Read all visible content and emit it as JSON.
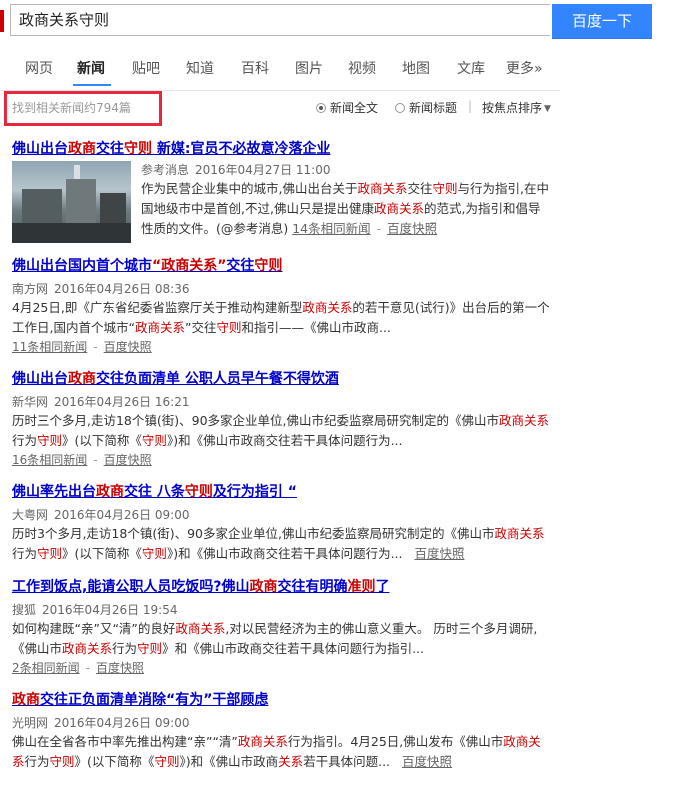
{
  "search": {
    "query": "政商关系守则",
    "button_label": "百度一下"
  },
  "nav": {
    "tabs": [
      {
        "label": "网页"
      },
      {
        "label": "新闻"
      },
      {
        "label": "贴吧"
      },
      {
        "label": "知道"
      },
      {
        "label": "百科"
      },
      {
        "label": "图片"
      },
      {
        "label": "视频"
      },
      {
        "label": "地图"
      },
      {
        "label": "文库"
      },
      {
        "label": "更多»"
      }
    ],
    "active": "新闻"
  },
  "toolbar": {
    "result_count": "找到相关新闻约794篇",
    "filter_full": "新闻全文",
    "filter_title": "新闻标题",
    "sort_label": "按焦点排序"
  },
  "results": [
    {
      "title_parts": [
        "佛山出台",
        "政商",
        "交往",
        "守则",
        " 新媒:官员不必故意冷落企业"
      ],
      "source": "参考消息",
      "date": "2016年04月27日 11:00",
      "summary_parts": [
        "作为民营企业集中的城市,佛山出台关于",
        "政商关系",
        "交往",
        "守则",
        "与行为指引,在中国地级市中是首创,不过,佛山只是提出健康",
        "政商关系",
        "的范式,为指引和倡导性质的文件。(@参考消息) "
      ],
      "related": "14条相同新闻",
      "cache": "百度快照",
      "has_thumb": true
    },
    {
      "title_parts": [
        "佛山出台国内首个城市",
        "“政商关系”",
        "交往",
        "守则"
      ],
      "source": "南方网",
      "date": "2016年04月26日 08:36",
      "summary_parts": [
        "4月25日,即《广东省纪委省监察厅关于推动构建新型",
        "政商关系",
        "的若干意见(试行)》出台后的第一个工作日,国内首个城市“",
        "政商关系",
        "”交往",
        "守则",
        "和指引——《佛山市政商..."
      ],
      "related": "11条相同新闻",
      "cache": "百度快照"
    },
    {
      "title_parts": [
        "佛山出台",
        "政商",
        "交往负面清单 公职人员早午餐不得饮酒"
      ],
      "source": "新华网",
      "date": "2016年04月26日 16:21",
      "summary_parts": [
        "历时三个多月,走访18个镇(街)、90多家企业单位,佛山市纪委监察局研究制定的《佛山市",
        "政商关系",
        "行为",
        "守则",
        "》(以下简称《",
        "守则",
        "》)和《佛山市政商交往若干具体问题行为..."
      ],
      "related": "16条相同新闻",
      "cache": "百度快照"
    },
    {
      "title_parts": [
        "佛山率先出台",
        "政商",
        "交往 八条",
        "守则",
        "及行为指引 “"
      ],
      "source": "大粤网",
      "date": "2016年04月26日 09:00",
      "summary_parts": [
        "历时3个多月,走访18个镇(街)、90多家企业单位,佛山市纪委监察局研究制定的《佛山市",
        "政商关系",
        "行为",
        "守则",
        "》(以下简称《",
        "守则",
        "》)和《佛山市政商交往若干具体问题行为..."
      ],
      "cache": "百度快照"
    },
    {
      "title_parts": [
        "工作到饭点,能请公职人员吃饭吗?佛山",
        "政商",
        "交往有明确",
        "准则",
        "了"
      ],
      "source": "搜狐",
      "date": "2016年04月26日 19:54",
      "summary_parts": [
        "如何构建既“亲”又“清”的良好",
        "政商关系",
        ",对以民营经济为主的佛山意义重大。 历时三个多月调研,《佛山市",
        "政商关系",
        "行为",
        "守则",
        "》和《佛山市政商交往若干具体问题行为指引..."
      ],
      "related": "2条相同新闻",
      "cache": "百度快照"
    },
    {
      "title_parts": [
        "政商",
        "交往正负面清单消除“有为”干部顾虑"
      ],
      "source": "光明网",
      "date": "2016年04月26日 09:00",
      "summary_parts": [
        "佛山在全省各市中率先推出构建“亲”“清”",
        "政商关系",
        "行为指引。4月25日,佛山发布《佛山市",
        "政商关系",
        "行为",
        "守则",
        "》(以下简称《",
        "守则",
        "》)和《佛山市政商",
        "关系",
        "若干具体问题..."
      ],
      "cache": "百度快照"
    }
  ],
  "colors": {
    "link": "#0000cc",
    "highlight": "#cc0000",
    "button": "#3385ff",
    "annotation_box": "#e8283c"
  }
}
